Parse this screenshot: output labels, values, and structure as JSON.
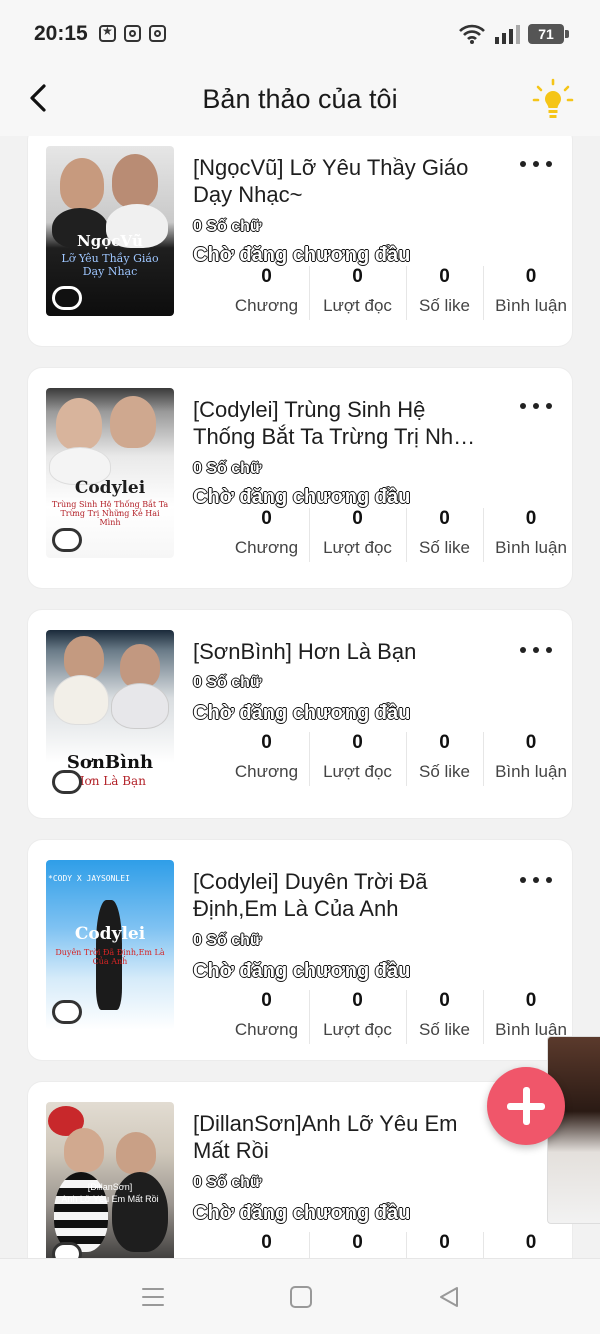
{
  "status_bar": {
    "time": "20:15",
    "battery": "71"
  },
  "header": {
    "title": "Bản thảo của tôi"
  },
  "stat_labels": [
    "Chương",
    "Lượt đọc",
    "Số like",
    "Bình luận"
  ],
  "drafts": [
    {
      "title": "[NgọcVũ] Lỡ Yêu Thầy Giáo Dạy Nhạc~",
      "word_count": "0 Số chữ",
      "status": "Chờ đăng chương đầu",
      "stats": [
        "0",
        "0",
        "0",
        "0"
      ],
      "cover_title": "NgọcVũ",
      "cover_sub": "Lỡ Yêu Thầy Giáo Dạy Nhạc"
    },
    {
      "title": "[Codylei] Trùng Sinh Hệ Thống Bắt Ta Trừng Trị Nh…",
      "word_count": "0 Số chữ",
      "status": "Chờ đăng chương đầu",
      "stats": [
        "0",
        "0",
        "0",
        "0"
      ],
      "cover_title": "Codylei",
      "cover_sub": "Trùng Sinh Hệ Thống Bắt Ta Trừng Trị Những Kẻ Hai Mình"
    },
    {
      "title": "[SơnBình] Hơn Là Bạn",
      "word_count": "0 Số chữ",
      "status": "Chờ đăng chương đầu",
      "stats": [
        "0",
        "0",
        "0",
        "0"
      ],
      "cover_title": "SơnBình",
      "cover_sub": "Hơn Là Bạn"
    },
    {
      "title": "[Codylei] Duyên Trời Đã Định,Em Là Của Anh",
      "word_count": "0 Số chữ",
      "status": "Chờ đăng chương đầu",
      "stats": [
        "0",
        "0",
        "0",
        "0"
      ],
      "cover_title": "Codylei",
      "cover_sub": "Duyên Trời Đã Định,Em Là Của Anh",
      "cover_top": "*CODY X JAYSONLEI"
    },
    {
      "title": "[DillanSơn]Anh Lỡ Yêu Em Mất Rồi",
      "word_count": "0 Số chữ",
      "status": "Chờ đăng chương đầu",
      "stats": [
        "0",
        "0",
        "0",
        "0"
      ],
      "cover_title": "[DillanSơn]",
      "cover_sub": "Anh Lỡ Yêu Em Mất Rồi"
    }
  ],
  "colors": {
    "fab": "#f0566a",
    "bulb": "#f5c518"
  },
  "icons": {
    "back": "back-arrow-icon",
    "tip": "lightbulb-icon",
    "more": "more-dots-icon",
    "add": "plus-icon"
  }
}
